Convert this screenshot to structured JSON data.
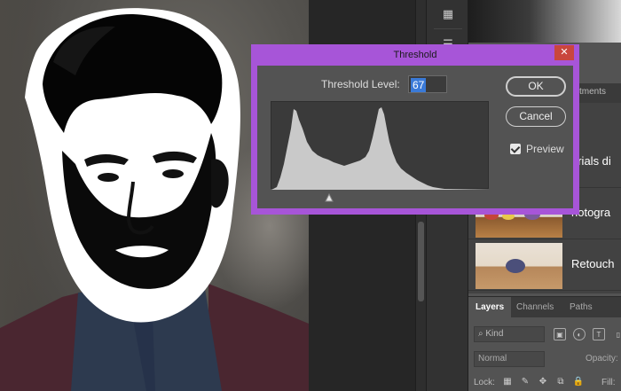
{
  "dialog": {
    "title": "Threshold",
    "close_icon": "close-icon",
    "threshold_level_label": "Threshold Level:",
    "threshold_value": "67",
    "ok_label": "OK",
    "cancel_label": "Cancel",
    "preview_label": "Preview",
    "preview_checked": true,
    "accent_color": "#a755d8",
    "close_color": "#c9463d"
  },
  "panels": {
    "adjustments_tab": "stments",
    "library_items": [
      {
        "title": "orials di"
      },
      {
        "title": "hotogra"
      },
      {
        "title": "Retouch"
      }
    ],
    "layers_tabs": [
      "Layers",
      "Channels",
      "Paths"
    ],
    "filter_kind": "Kind",
    "blend_mode": "Normal",
    "opacity_label": "Opacity:",
    "lock_label": "Lock:",
    "fill_label": "Fill:"
  }
}
